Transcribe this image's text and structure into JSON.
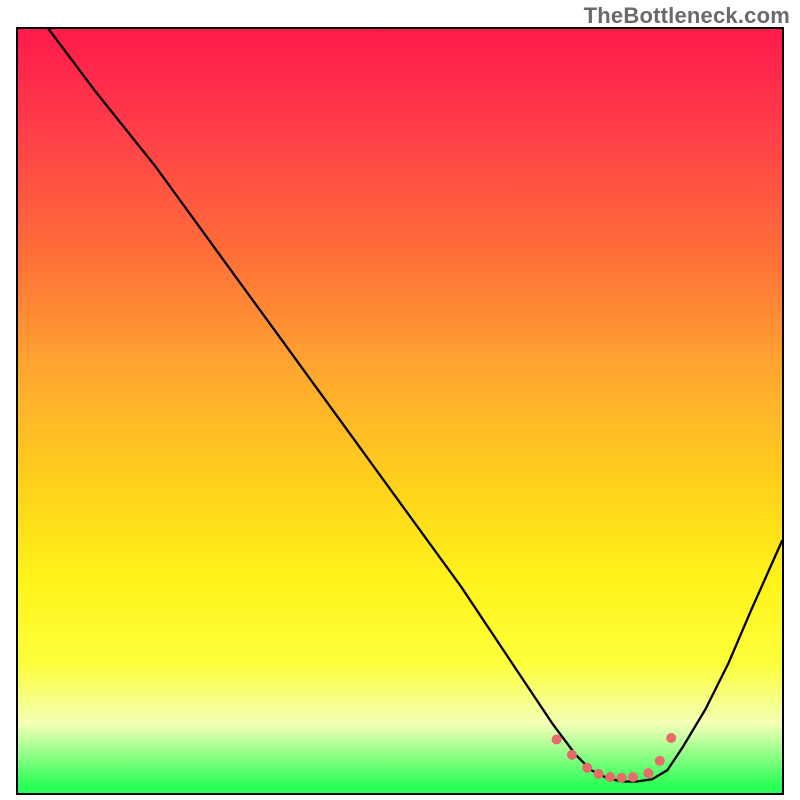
{
  "watermark": "TheBottleneck.com",
  "chart_data": {
    "type": "line",
    "title": "",
    "xlabel": "",
    "ylabel": "",
    "xlim": [
      0,
      100
    ],
    "ylim": [
      0,
      100
    ],
    "grid": false,
    "legend": false,
    "series": [
      {
        "name": "bottleneck-curve",
        "x": [
          4,
          10,
          18,
          26,
          34,
          42,
          50,
          58,
          62,
          66,
          70,
          73,
          75,
          77,
          79,
          81,
          83,
          85,
          87,
          90,
          93,
          96,
          100
        ],
        "y": [
          100,
          92,
          82,
          71,
          60,
          49,
          38,
          27,
          21,
          15,
          9,
          5,
          3,
          2,
          1.5,
          1.5,
          1.8,
          3,
          6,
          11,
          17,
          24,
          33
        ]
      }
    ],
    "markers": {
      "name": "flat-region-dots",
      "color": "#e86a6a",
      "x": [
        70.5,
        72.5,
        74.5,
        76,
        77.5,
        79,
        80.5,
        82.5,
        84,
        85.5
      ],
      "y": [
        7,
        5,
        3.3,
        2.5,
        2.1,
        2.0,
        2.1,
        2.6,
        4.2,
        7.2
      ]
    }
  }
}
